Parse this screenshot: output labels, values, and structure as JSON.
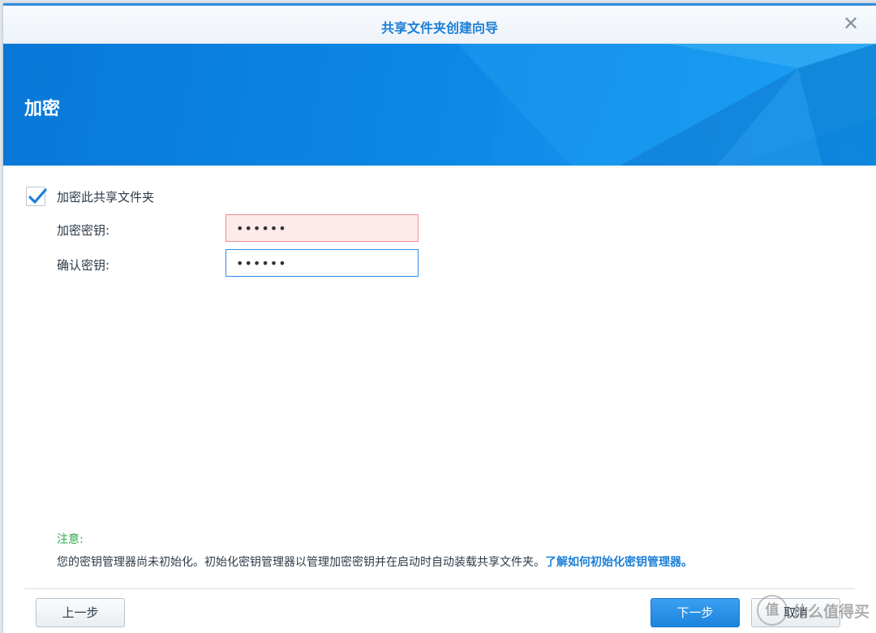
{
  "window": {
    "title": "共享文件夹创建向导",
    "close_glyph": "✕"
  },
  "banner": {
    "title": "加密"
  },
  "encrypt": {
    "checkbox_label": "加密此共享文件夹",
    "checked": true,
    "key_label": "加密密钥:",
    "key_value": "••••••",
    "confirm_label": "确认密钥:",
    "confirm_value": "••••••"
  },
  "note": {
    "title": "注意:",
    "text": "您的密钥管理器尚未初始化。初始化密钥管理器以管理加密密钥并在启动时自动装载共享文件夹。",
    "link": "了解如何初始化密钥管理器。"
  },
  "buttons": {
    "prev": "上一步",
    "next": "下一步",
    "cancel": "取消"
  },
  "watermark": {
    "logo": "值",
    "text": "什么值得买"
  },
  "colors": {
    "accent": "#1b7fd6",
    "error_bg": "#fdeaea",
    "note_green": "#2ea84a"
  },
  "icons": {
    "close": "close-icon",
    "check": "checkmark-icon"
  }
}
